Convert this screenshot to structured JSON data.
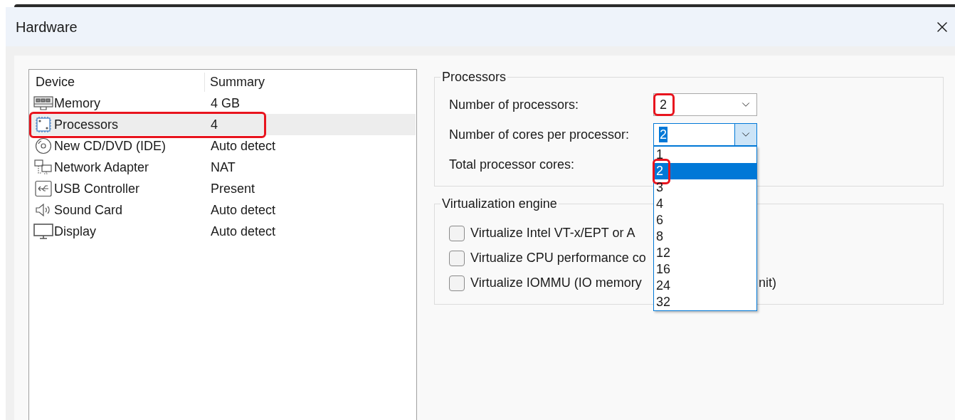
{
  "window": {
    "title": "Hardware"
  },
  "device_list": {
    "columns": [
      "Device",
      "Summary"
    ],
    "rows": [
      {
        "kind": "memory",
        "device": "Memory",
        "summary": "4 GB",
        "selected": false,
        "highlighted": false
      },
      {
        "kind": "processor",
        "device": "Processors",
        "summary": "4",
        "selected": true,
        "highlighted": true
      },
      {
        "kind": "disc",
        "device": "New CD/DVD (IDE)",
        "summary": "Auto detect",
        "selected": false,
        "highlighted": false
      },
      {
        "kind": "network",
        "device": "Network Adapter",
        "summary": "NAT",
        "selected": false,
        "highlighted": false
      },
      {
        "kind": "usb",
        "device": "USB Controller",
        "summary": "Present",
        "selected": false,
        "highlighted": false
      },
      {
        "kind": "sound",
        "device": "Sound Card",
        "summary": "Auto detect",
        "selected": false,
        "highlighted": false
      },
      {
        "kind": "display",
        "device": "Display",
        "summary": "Auto detect",
        "selected": false,
        "highlighted": false
      }
    ]
  },
  "processors": {
    "title": "Processors",
    "fields": [
      {
        "kind": "combo",
        "label": "Number of processors:",
        "value": "2",
        "focused": false,
        "highlighted": true,
        "expanded": false
      },
      {
        "kind": "combo",
        "label": "Number of cores per processor:",
        "value": "2",
        "focused": true,
        "highlighted": false,
        "expanded": true
      },
      {
        "kind": "text",
        "label": "Total processor cores:"
      }
    ]
  },
  "dropdown": {
    "options": [
      {
        "label": "1",
        "selected": false,
        "highlighted": false
      },
      {
        "label": "2",
        "selected": true,
        "highlighted": true
      },
      {
        "label": "3",
        "selected": false,
        "highlighted": false
      },
      {
        "label": "4",
        "selected": false,
        "highlighted": false
      },
      {
        "label": "6",
        "selected": false,
        "highlighted": false
      },
      {
        "label": "8",
        "selected": false,
        "highlighted": false
      },
      {
        "label": "12",
        "selected": false,
        "highlighted": false
      },
      {
        "label": "16",
        "selected": false,
        "highlighted": false
      },
      {
        "label": "24",
        "selected": false,
        "highlighted": false
      },
      {
        "label": "32",
        "selected": false,
        "highlighted": false
      }
    ]
  },
  "virtualization": {
    "title": "Virtualization engine",
    "options": [
      {
        "label": "Virtualize Intel VT-x/EPT or A",
        "checked": false
      },
      {
        "label": "Virtualize CPU performance co",
        "checked": false
      },
      {
        "label": "Virtualize IOMMU (IO memory",
        "tail": "nit)",
        "checked": false
      }
    ]
  }
}
